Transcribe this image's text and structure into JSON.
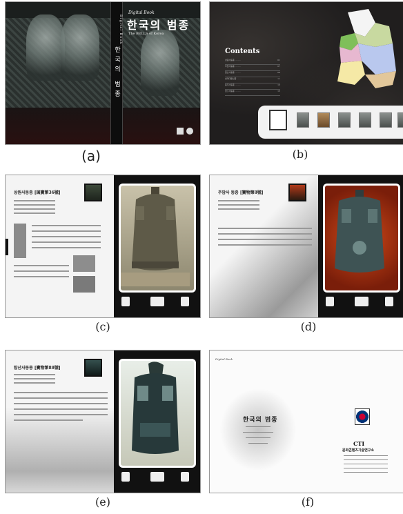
{
  "panels": {
    "a": {
      "caption": "(a)",
      "book_series": "Digital Book",
      "title": "한국의 범종",
      "subtitle": "The BELLS of Korea",
      "spine_series": "Digital Book",
      "spine_title": "한국의 범종"
    },
    "b": {
      "caption": "(b)",
      "contents_title": "Contents",
      "contents_rows": 6
    },
    "c": {
      "caption": "(c)",
      "page_heading": "상원사동종 [国寶第36號]"
    },
    "d": {
      "caption": "(d)",
      "page_heading": "주암사 동종 [寶物第8號]"
    },
    "e": {
      "caption": "(e)",
      "page_heading": "탑산사동종 [寶物第88號]"
    },
    "f": {
      "caption": "(f)",
      "book_series": "Digital Book",
      "title": "한국의 범종",
      "org_name": "CTI",
      "org_name_korean": "문화콘텐츠기술연구소"
    }
  },
  "colors": {
    "cover_dark": "#1b1f1e",
    "page_light": "#f4f4f4",
    "frame_dark": "#111111",
    "bell_bronze": "#7a6a45",
    "map_regions": [
      "#c8d9a0",
      "#7fbf5a",
      "#e7b8d0",
      "#b9c8ee",
      "#f5e9a6",
      "#e2c79a"
    ]
  }
}
